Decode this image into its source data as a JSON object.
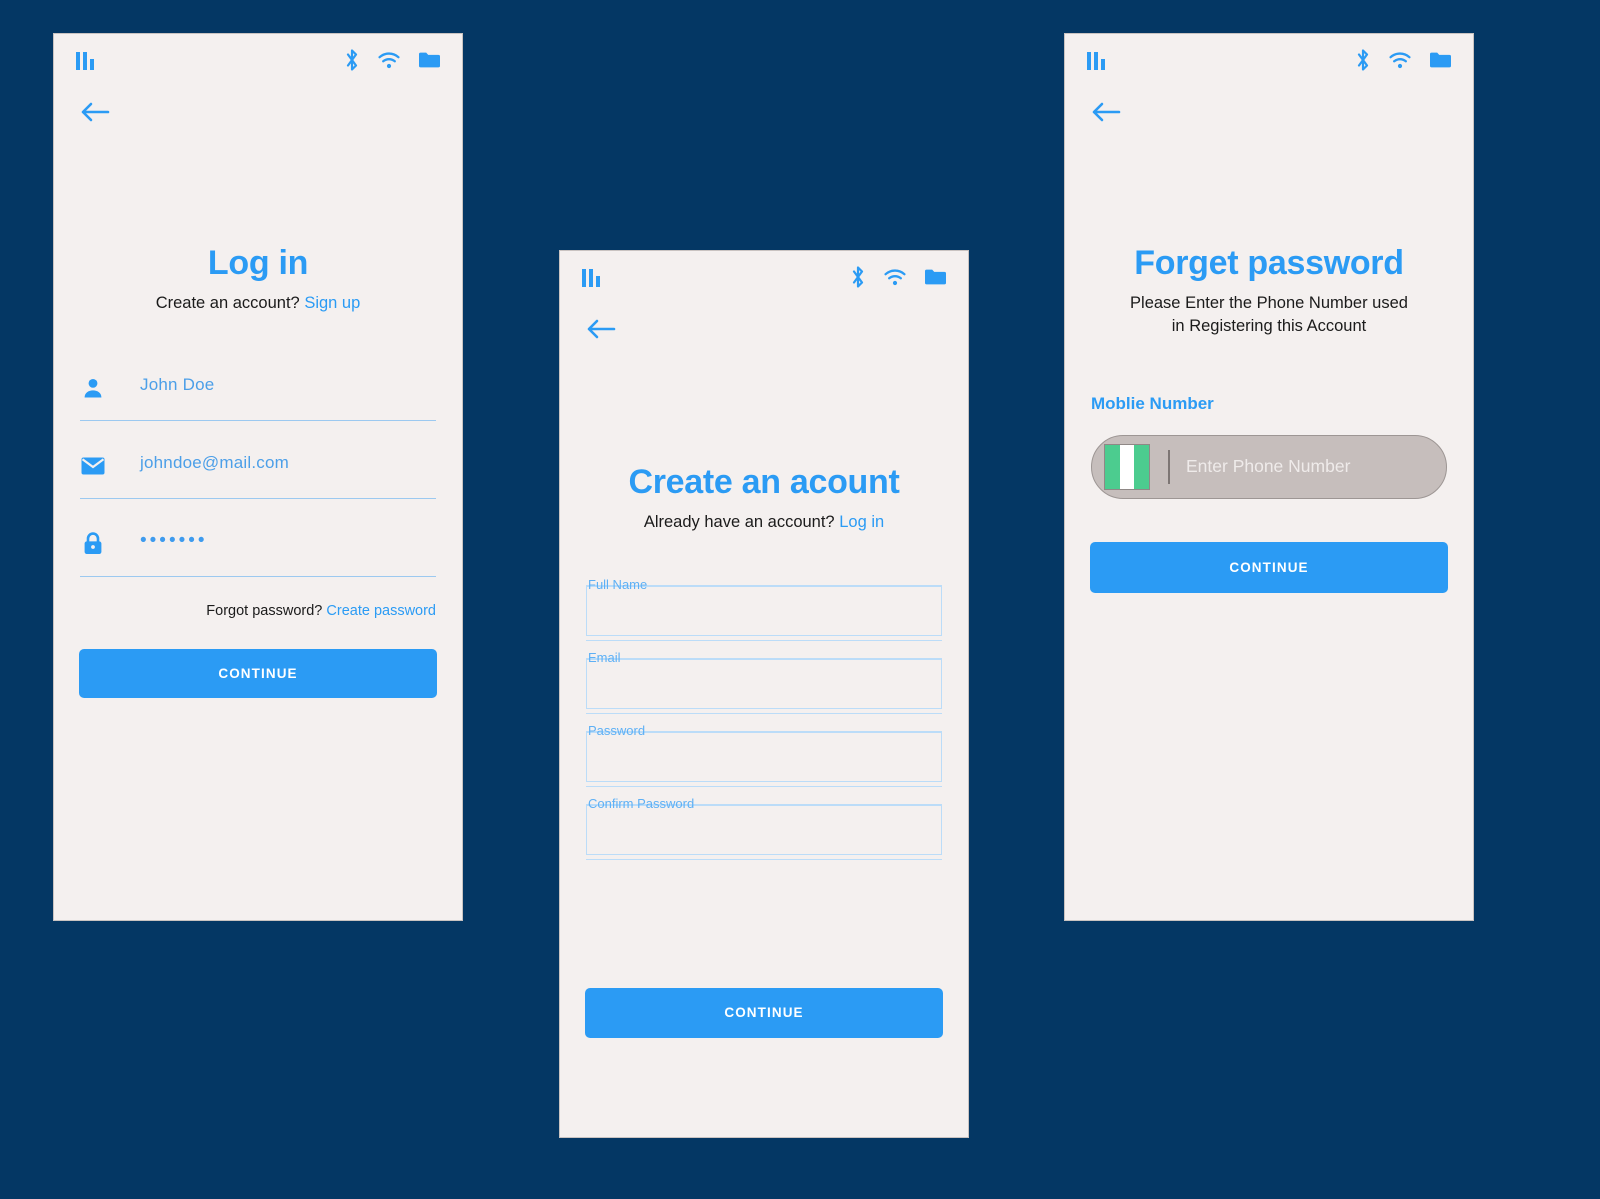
{
  "theme": {
    "background": "#043764",
    "card_background": "#F4F0EF",
    "accent_blue": "#2B9BF4",
    "field_line_blue": "#BBDCF8",
    "phone_input_fill": "#C6BEBC",
    "flag_green": "#4CCC8F",
    "flag_white": "#FFFFFF"
  },
  "status_bar": {
    "signal_icon": "signal-bars-icon",
    "bluetooth_icon": "bluetooth-icon",
    "wifi_icon": "wifi-icon",
    "folder_icon": "folder-icon"
  },
  "screens": {
    "login": {
      "back_icon": "back-arrow-icon",
      "title": "Log in",
      "subtitle_text": "Create an account?",
      "subtitle_link": "Sign up",
      "fields": [
        {
          "icon": "person-icon",
          "value": "John Doe"
        },
        {
          "icon": "envelope-icon",
          "value": "johndoe@mail.com"
        },
        {
          "icon": "lock-icon",
          "value": "•••••••"
        }
      ],
      "forgot_text": "Forgot password?",
      "forgot_link": "Create password",
      "continue_label": "CONTINUE"
    },
    "signup": {
      "back_icon": "back-arrow-icon",
      "title": "Create an acount",
      "subtitle_text": "Already have an account?",
      "subtitle_link": "Log in",
      "fields": [
        {
          "label": "Full Name",
          "value": ""
        },
        {
          "label": "Email",
          "value": ""
        },
        {
          "label": "Password",
          "value": ""
        },
        {
          "label": "Confirm Password",
          "value": ""
        }
      ],
      "continue_label": "CONTINUE"
    },
    "forgot": {
      "back_icon": "back-arrow-icon",
      "title": "Forget password",
      "subtitle_line1": "Please Enter the Phone Number used",
      "subtitle_line2": "in Registering this Account",
      "field_label": "Moblie Number",
      "flag_icon": "nigeria-flag-icon",
      "phone_placeholder": "Enter Phone Number",
      "continue_label": "CONTINUE"
    }
  }
}
